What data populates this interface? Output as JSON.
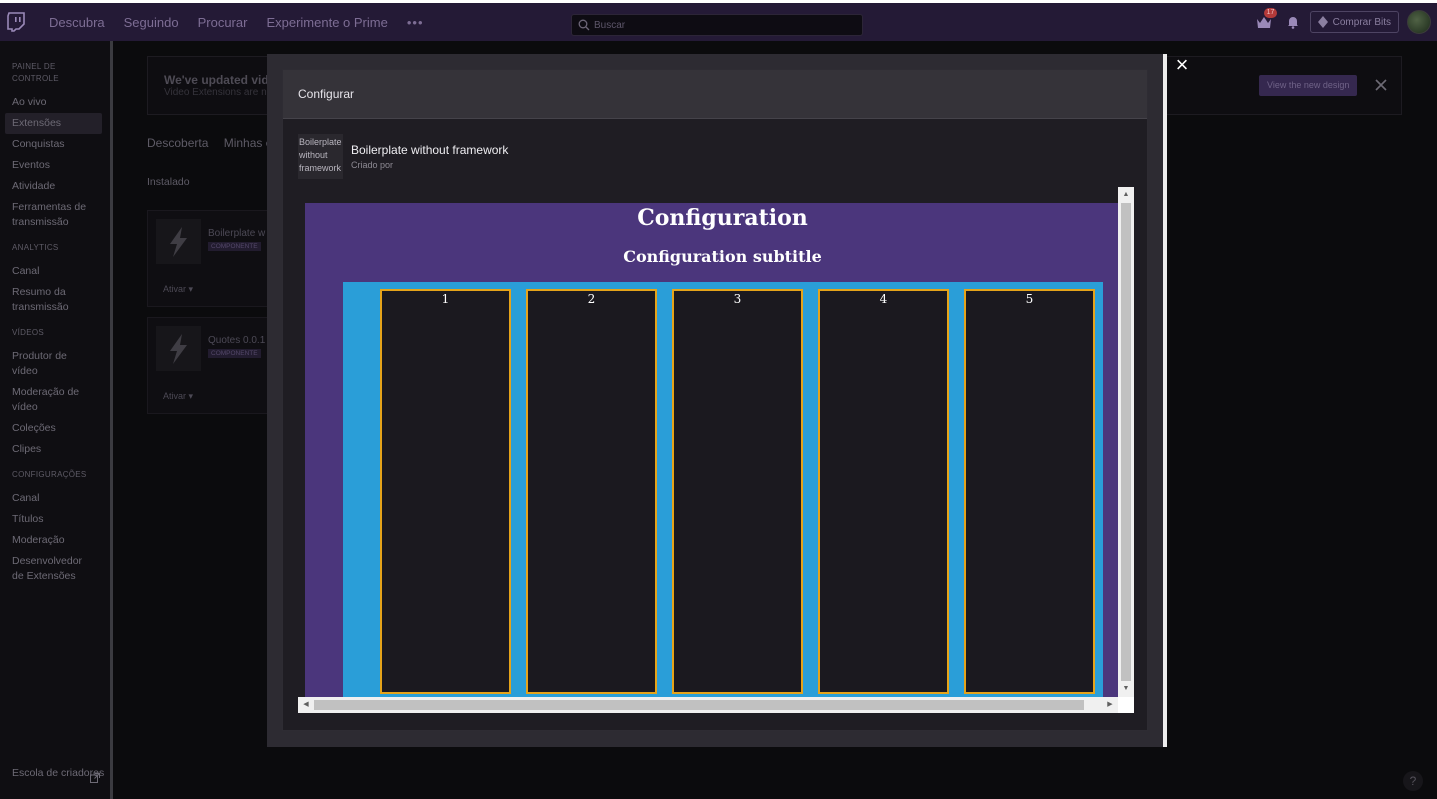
{
  "topbar": {
    "nav": [
      "Descubra",
      "Seguindo",
      "Procurar",
      "Experimente o Prime"
    ],
    "more": "•••",
    "search_placeholder": "Buscar",
    "notifications_count": "17",
    "buy_bits": "Comprar Bits"
  },
  "sidebar": {
    "sections": [
      {
        "title": "PAINEL DE CONTROLE",
        "items": [
          "Ao vivo",
          "Extensões",
          "Conquistas",
          "Eventos",
          "Atividade",
          "Ferramentas de transmissão"
        ]
      },
      {
        "title": "ANALYTICS",
        "items": [
          "Canal",
          "Resumo da transmissão"
        ]
      },
      {
        "title": "VÍDEOS",
        "items": [
          "Produtor de vídeo",
          "Moderação de vídeo",
          "Coleções",
          "Clipes"
        ]
      },
      {
        "title": "CONFIGURAÇÕES",
        "items": [
          "Canal",
          "Títulos",
          "Moderação",
          "Desenvolvedor de Extensões"
        ]
      }
    ],
    "active_item": "Extensões",
    "bottom": "Escola de criadores"
  },
  "background": {
    "banner_title": "We've updated vid",
    "banner_sub": "Video Extensions are n",
    "new_design_button": "View the new design",
    "tabs": [
      "Descoberta",
      "Minhas e"
    ],
    "installed": "Instalado",
    "cards": [
      {
        "name": "Boilerplate w",
        "tag": "COMPONENTE",
        "action": "Ativar"
      },
      {
        "name": "Quotes 0.0.1",
        "tag": "COMPONENTE",
        "action": "Ativar"
      }
    ],
    "help": "?"
  },
  "modal": {
    "title": "Configurar",
    "close": "×",
    "extension_image_alt": "Boilerplate without framework",
    "extension_name": "Boilerplate without framework",
    "created_by": "Criado por",
    "config": {
      "title": "Configuration",
      "subtitle": "Configuration subtitle",
      "columns": [
        "1",
        "2",
        "3",
        "4",
        "5"
      ]
    }
  }
}
